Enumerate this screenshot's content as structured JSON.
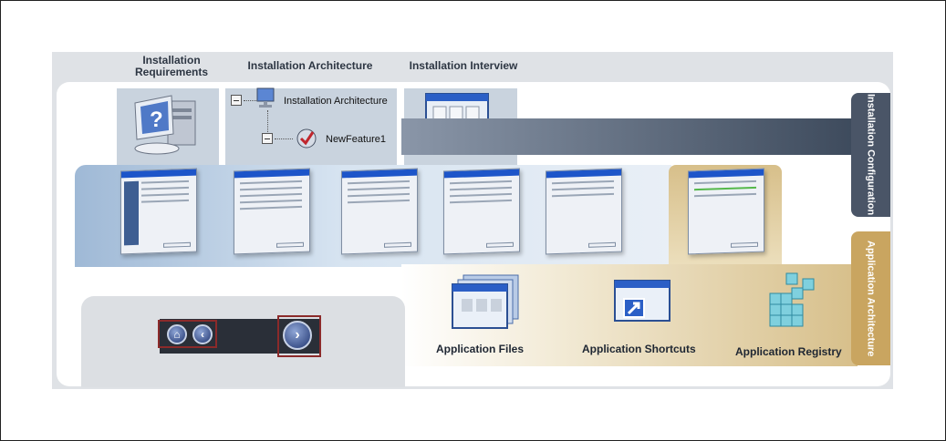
{
  "headers": {
    "requirements": "Installation Requirements",
    "architecture": "Installation Architecture",
    "interview": "Installation Interview"
  },
  "tree": {
    "root_label": "Installation Architecture",
    "child_label": "NewFeature1"
  },
  "side_tabs": {
    "configuration": "Installation Configuration",
    "application": "Application Architecture"
  },
  "app_items": {
    "files": "Application Files",
    "shortcuts": "Application Shortcuts",
    "registry": "Application Registry"
  },
  "nav": {
    "home_icon": "home-icon",
    "back_icon": "arrow-left-icon",
    "next_icon": "arrow-right-icon"
  },
  "colors": {
    "dark_tab": "#4a5567",
    "gold_tab": "#c9a560",
    "highlight": "#8b2a2a",
    "accent_blue": "#1d55c9"
  }
}
